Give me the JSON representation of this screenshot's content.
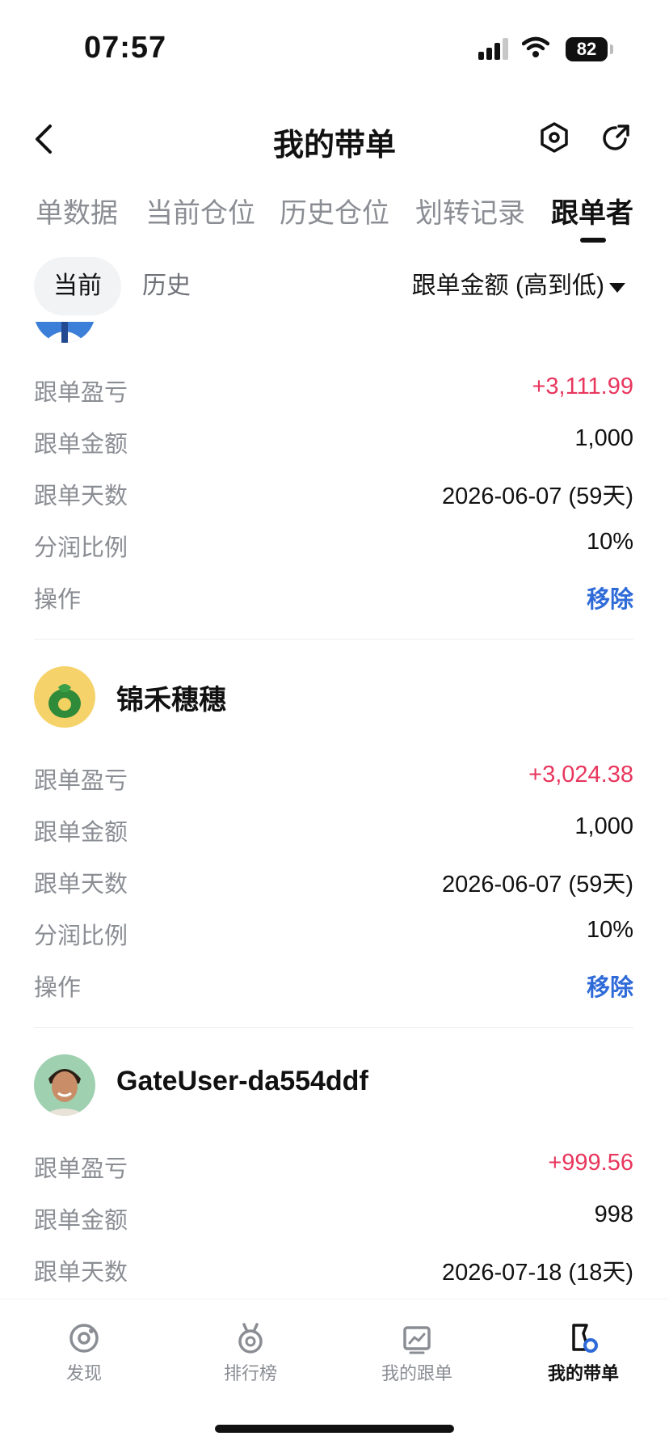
{
  "status_bar": {
    "time": "07:57",
    "battery": "82"
  },
  "header": {
    "title": "我的带单"
  },
  "tabs": [
    {
      "label": "单数据",
      "active": false
    },
    {
      "label": "当前仓位",
      "active": false
    },
    {
      "label": "历史仓位",
      "active": false
    },
    {
      "label": "划转记录",
      "active": false
    },
    {
      "label": "跟单者",
      "active": true
    }
  ],
  "filter": {
    "current": "当前",
    "history": "历史",
    "sort": "跟单金额 (高到低)"
  },
  "cards": [
    {
      "name": "",
      "rows": [
        {
          "label": "跟单盈亏",
          "value": "+3,111.99"
        },
        {
          "label": "跟单金额",
          "value": "1,000"
        },
        {
          "label": "跟单天数",
          "value": "2026-06-07 (59天)"
        },
        {
          "label": "分润比例",
          "value": "10%"
        },
        {
          "label": "操作",
          "value": "移除"
        }
      ]
    },
    {
      "name": "锦禾穗穗",
      "rows": [
        {
          "label": "跟单盈亏",
          "value": "+3,024.38"
        },
        {
          "label": "跟单金额",
          "value": "1,000"
        },
        {
          "label": "跟单天数",
          "value": "2026-06-07 (59天)"
        },
        {
          "label": "分润比例",
          "value": "10%"
        },
        {
          "label": "操作",
          "value": "移除"
        }
      ]
    },
    {
      "name": "GateUser-da554ddf",
      "rows": [
        {
          "label": "跟单盈亏",
          "value": "+999.56"
        },
        {
          "label": "跟单金额",
          "value": "998"
        },
        {
          "label": "跟单天数",
          "value": "2026-07-18 (18天)"
        }
      ]
    }
  ],
  "bottom_nav": [
    {
      "label": "发现",
      "icon": "discover-icon",
      "active": false
    },
    {
      "label": "排行榜",
      "icon": "medal-icon",
      "active": false
    },
    {
      "label": "我的跟单",
      "icon": "chart-icon",
      "active": false
    },
    {
      "label": "我的带单",
      "icon": "lead-icon",
      "active": true
    }
  ],
  "colors": {
    "profit": "#e8365d",
    "action": "#2f6bd8"
  }
}
